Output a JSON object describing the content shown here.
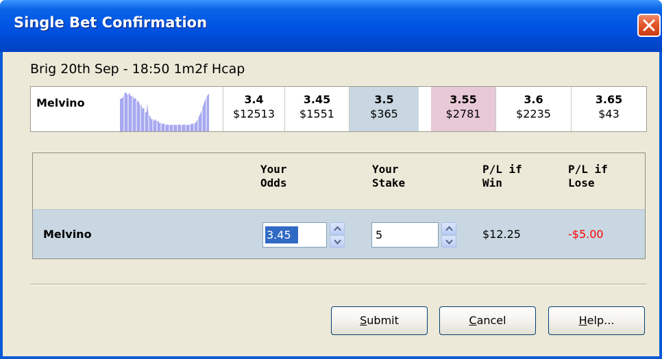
{
  "window": {
    "title": "Single Bet Confirmation"
  },
  "race": {
    "title": "Brig 20th Sep - 18:50 1m2f Hcap"
  },
  "ladder": {
    "runner": "Melvino",
    "back_prices": [
      {
        "odds": "3.4",
        "amount": "$12513"
      },
      {
        "odds": "3.45",
        "amount": "$1551"
      },
      {
        "odds": "3.5",
        "amount": "$365"
      }
    ],
    "lay_prices": [
      {
        "odds": "3.55",
        "amount": "$2781"
      },
      {
        "odds": "3.6",
        "amount": "$2235"
      },
      {
        "odds": "3.65",
        "amount": "$43"
      }
    ]
  },
  "bet_table": {
    "headers": {
      "your_odds_1": "Your",
      "your_odds_2": "Odds",
      "your_stake_1": "Your",
      "your_stake_2": "Stake",
      "pl_win_1": "P/L if",
      "pl_win_2": "Win",
      "pl_lose_1": "P/L if",
      "pl_lose_2": "Lose"
    },
    "row": {
      "runner": "Melvino",
      "odds_value": "3.45",
      "stake_value": "5",
      "pl_win": "$12.25",
      "pl_lose": "-$5.00"
    }
  },
  "buttons": {
    "submit_key": "S",
    "submit_rest": "ubmit",
    "cancel_key": "C",
    "cancel_rest": "ancel",
    "help_key": "H",
    "help_rest": "elp..."
  },
  "icons": {
    "close": "close-icon",
    "spin_up": "chevron-up-icon",
    "spin_down": "chevron-down-icon",
    "sparkline": "price-history-sparkline"
  },
  "colors": {
    "titlebar": "#0055e5",
    "dialog_bg": "#ece9d8",
    "back": "#c8d7e1",
    "lay": "#e8c9d6",
    "negative": "#ff0000",
    "sparkline": "#a7a8f0"
  }
}
